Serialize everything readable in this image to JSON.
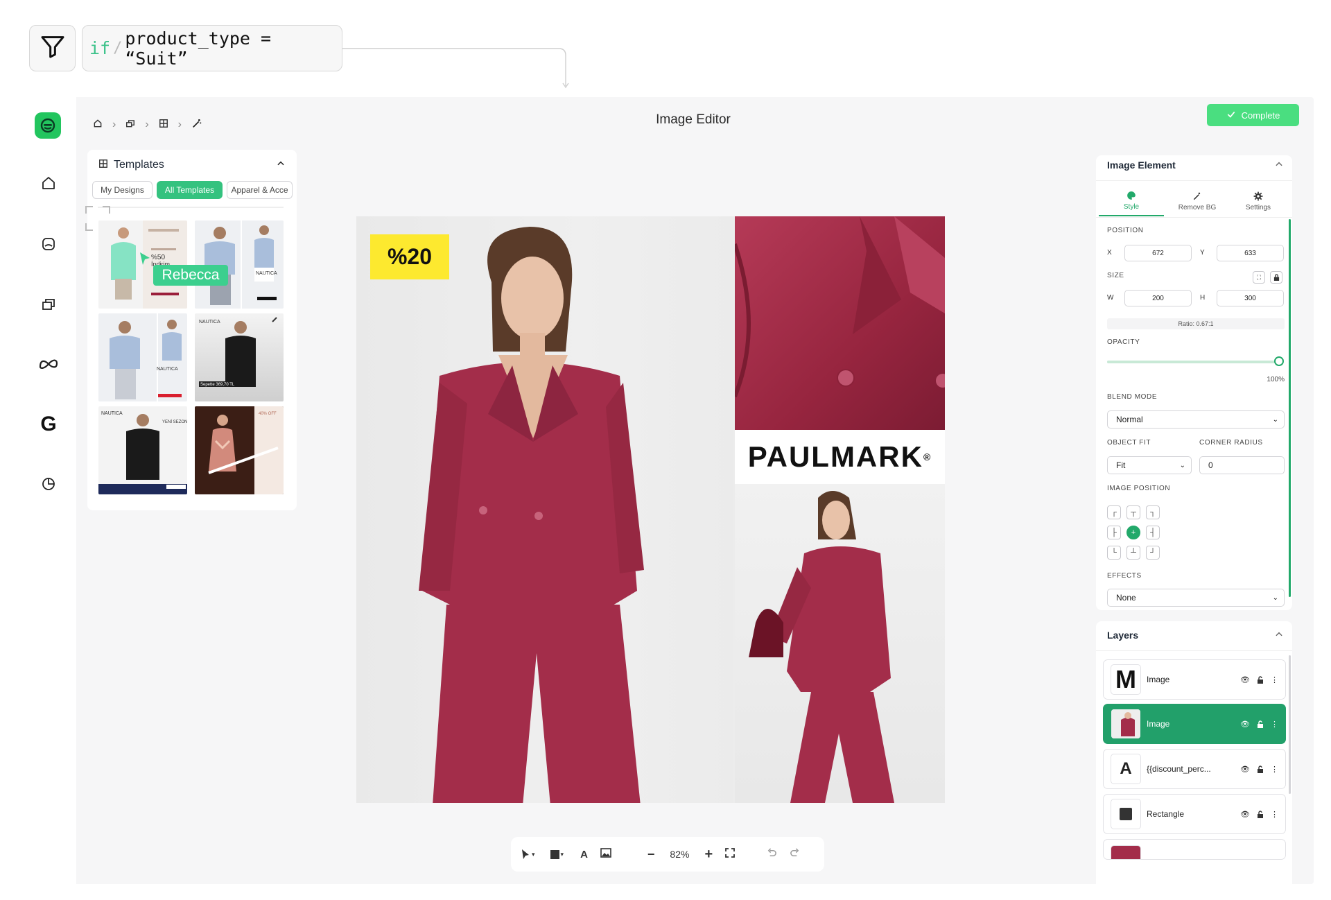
{
  "filter": {
    "keyword": "if",
    "separator": "/",
    "expression": "product_type = “Suit”"
  },
  "header": {
    "title": "Image Editor",
    "complete_label": "Complete"
  },
  "templates": {
    "title": "Templates",
    "tabs": [
      "My Designs",
      "All Templates",
      "Apparel & Acce"
    ],
    "active_tab": "All Templates",
    "cursor_label": "Rebecca"
  },
  "canvas": {
    "badge": "%20",
    "brand": "PAULMARK"
  },
  "toolbar": {
    "zoom": "82%"
  },
  "inspector": {
    "title": "Image Element",
    "tabs": [
      "Style",
      "Remove BG",
      "Settings"
    ],
    "position_label": "POSITION",
    "x_label": "X",
    "x": "672",
    "y_label": "Y",
    "y": "633",
    "size_label": "SIZE",
    "w_label": "W",
    "w": "200",
    "h_label": "H",
    "h": "300",
    "ratio": "Ratio: 0.67:1",
    "opacity_label": "OPACITY",
    "opacity_value": "100%",
    "opacity_fraction": 1.0,
    "blend_label": "BLEND MODE",
    "blend_value": "Normal",
    "fit_label": "OBJECT FIT",
    "fit_value": "Fit",
    "radius_label": "CORNER RADIUS",
    "radius_value": "0",
    "image_position_label": "IMAGE POSITION",
    "effects_label": "EFFECTS",
    "effects_value": "None"
  },
  "layers": {
    "title": "Layers",
    "items": [
      {
        "name": "Image",
        "thumb": "M"
      },
      {
        "name": "Image",
        "thumb": "photo"
      },
      {
        "name": "{{discount_perc...",
        "thumb": "A"
      },
      {
        "name": "Rectangle",
        "thumb": "rect"
      }
    ]
  },
  "colors": {
    "accent": "#22a96a",
    "complete": "#4ade80",
    "badge": "#fde92f",
    "suit": "#a32d4a"
  }
}
